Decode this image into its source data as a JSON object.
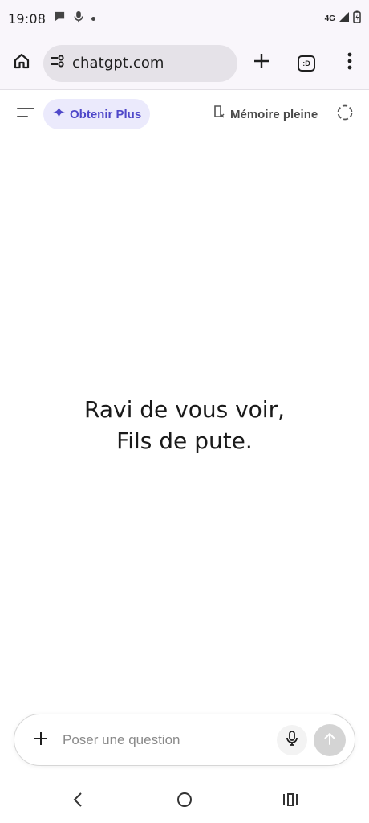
{
  "status_bar": {
    "time": "19:08",
    "network": "4G",
    "icons": [
      "chat-bubble-icon",
      "mic-notification-icon",
      "dot-icon",
      "signal-icon",
      "battery-icon"
    ]
  },
  "browser": {
    "url": "chatgpt.com",
    "tabs_label": ":D",
    "icons": [
      "home-icon",
      "site-info-icon",
      "plus-icon",
      "tabs-icon",
      "more-vert-icon"
    ]
  },
  "header": {
    "upgrade_label": "Obtenir Plus",
    "memory_label": "Mémoire pleine",
    "accent_color": "#4f48c9"
  },
  "greeting": {
    "line1": "Ravi de vous voir,",
    "line2": "Fils de pute."
  },
  "composer": {
    "placeholder": "Poser une question",
    "value": ""
  },
  "nav": {
    "icons": [
      "back-icon",
      "home-circle-icon",
      "recent-apps-icon"
    ]
  }
}
